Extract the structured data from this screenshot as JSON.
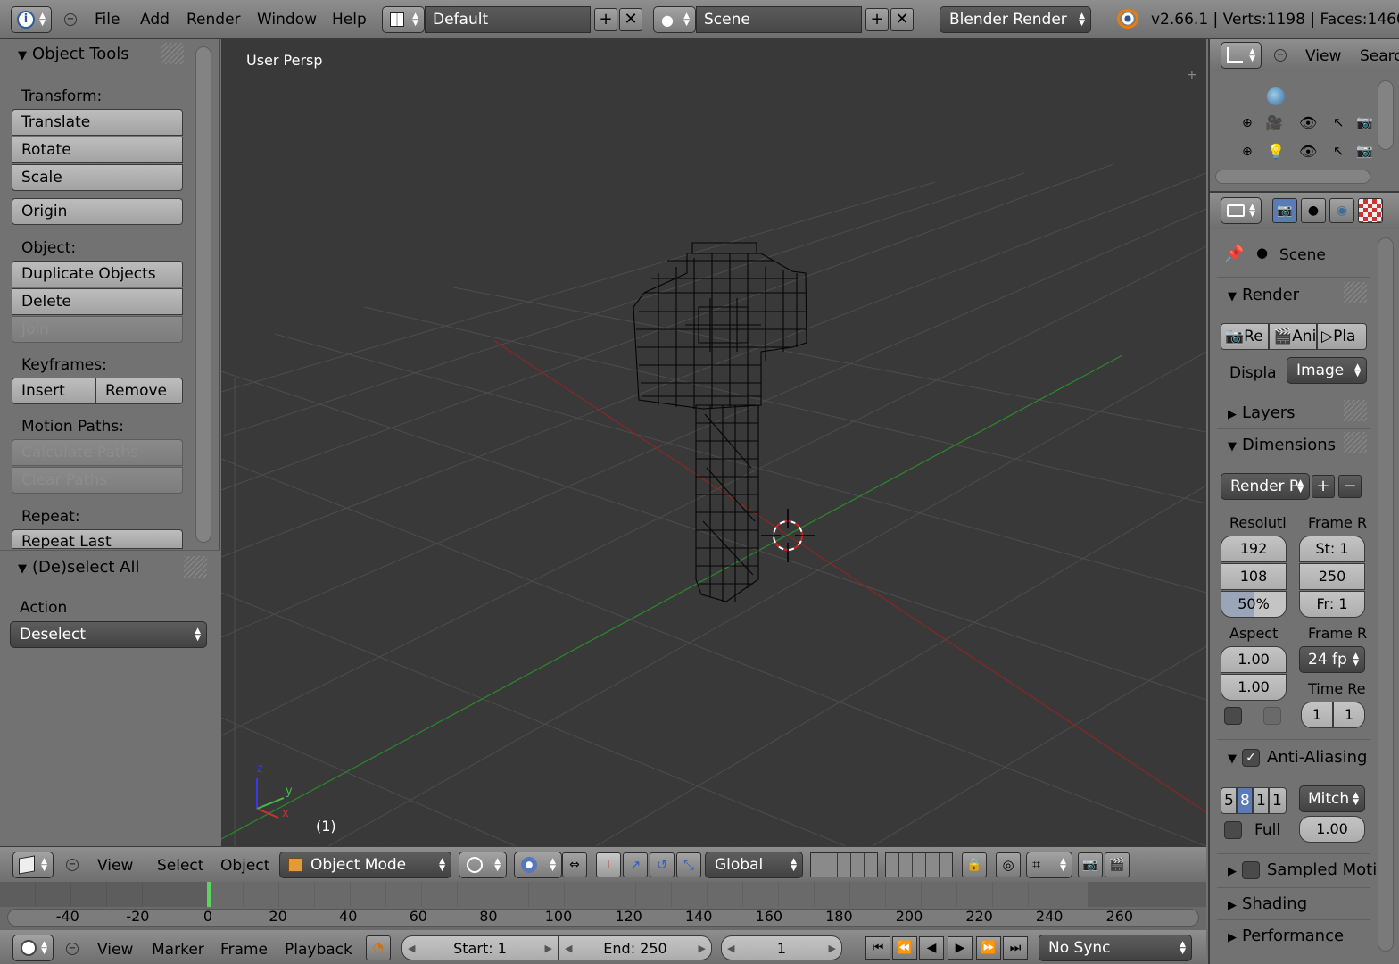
{
  "top_bar": {
    "menus": [
      "File",
      "Add",
      "Render",
      "Window",
      "Help"
    ],
    "screen_layout": "Default",
    "scene": "Scene",
    "render_engine": "Blender Render",
    "stats": "v2.66.1 | Verts:1198 | Faces:1460"
  },
  "tool_shelf": {
    "title": "Object Tools",
    "transform_label": "Transform:",
    "transform_buttons": [
      "Translate",
      "Rotate",
      "Scale"
    ],
    "origin_button": "Origin",
    "object_label": "Object:",
    "object_buttons": [
      "Duplicate Objects",
      "Delete",
      "Join"
    ],
    "keyframes_label": "Keyframes:",
    "insert_label": "Insert",
    "remove_label": "Remove",
    "motion_paths_label": "Motion Paths:",
    "calculate_paths": "Calculate Paths",
    "clear_paths": "Clear Paths",
    "repeat_label": "Repeat:",
    "repeat_last": "Repeat Last",
    "operator_title": "(De)select All",
    "action_label": "Action",
    "action_value": "Deselect"
  },
  "viewport": {
    "view_name": "User Persp",
    "frame_indicator": "(1)",
    "axis_labels": {
      "x": "x",
      "y": "y",
      "z": "z"
    }
  },
  "viewport_header": {
    "menus": [
      "View",
      "Select",
      "Object"
    ],
    "mode": "Object Mode",
    "orientation": "Global"
  },
  "timeline": {
    "ticks": [
      "-40",
      "-20",
      "0",
      "20",
      "40",
      "60",
      "80",
      "100",
      "120",
      "140",
      "160",
      "180",
      "200",
      "220",
      "240",
      "260"
    ],
    "current_frame": 1
  },
  "timeline_footer": {
    "menus": [
      "View",
      "Marker",
      "Frame",
      "Playback"
    ],
    "start": "Start: 1",
    "end": "End: 250",
    "current": "1",
    "sync": "No Sync"
  },
  "outliner": {
    "view_menu": "View",
    "search_menu": "Searc"
  },
  "properties": {
    "scene_label": "Scene",
    "render_section": "Render",
    "render_buttons": [
      "Re",
      "Ani",
      "Pla"
    ],
    "display_label": "Displa",
    "display_value": "Image",
    "layers_section": "Layers",
    "dimensions_section": "Dimensions",
    "preset_label": "Render P",
    "resolution_label": "Resoluti",
    "frame_range_label": "Frame R",
    "res_x": "192",
    "res_y": "108",
    "res_pct": "50%",
    "frame_start": "St: 1",
    "frame_end": "250",
    "frame_step": "Fr: 1",
    "aspect_label": "Aspect",
    "frame_rate_label": "Frame R",
    "aspect_x": "1.00",
    "aspect_y": "1.00",
    "fps": "24 fp",
    "time_remap_label": "Time Re",
    "time_old": "1",
    "time_new": "1",
    "antialiasing_section": "Anti-Aliasing",
    "aa_samples": [
      "5",
      "8",
      "1",
      "1"
    ],
    "aa_filter": "Mitch",
    "full_sample_label": "Full",
    "filter_size": "1.00",
    "sampled_motion_section": "Sampled Moti",
    "shading_section": "Shading",
    "performance_section": "Performance"
  }
}
